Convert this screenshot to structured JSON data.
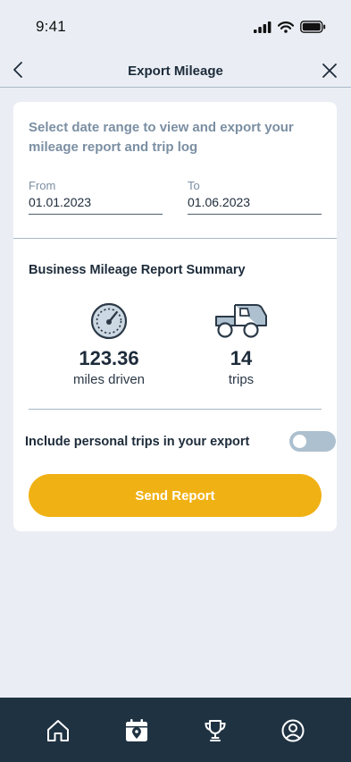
{
  "status_bar": {
    "time": "9:41",
    "icons": [
      "signal-icon",
      "wifi-icon",
      "battery-icon"
    ]
  },
  "header": {
    "title": "Export Mileage",
    "back_icon": "chevron-left-icon",
    "close_icon": "close-icon"
  },
  "export": {
    "intro": "Select date range to view and export your mileage report and trip log",
    "from": {
      "label": "From",
      "value": "01.01.2023"
    },
    "to": {
      "label": "To",
      "value": "01.06.2023"
    }
  },
  "summary": {
    "title": "Business Mileage Report Summary",
    "miles": {
      "icon": "speedometer-icon",
      "value": "123.36",
      "label": "miles driven"
    },
    "trips": {
      "icon": "truck-icon",
      "value": "14",
      "label": "trips"
    }
  },
  "personal_trips": {
    "label": "Include personal trips in your export",
    "enabled": false
  },
  "send_button": {
    "label": "Send Report"
  },
  "tab_bar": {
    "items": [
      "home-icon",
      "calendar-pin-icon",
      "trophy-icon",
      "profile-icon"
    ],
    "active": "calendar-pin-icon"
  },
  "colors": {
    "background": "#eaeef4",
    "accent": "#f0b114",
    "tab_bar": "#1f3242",
    "muted_text": "#7b8fa3",
    "toggle_off": "#adc0cf"
  }
}
